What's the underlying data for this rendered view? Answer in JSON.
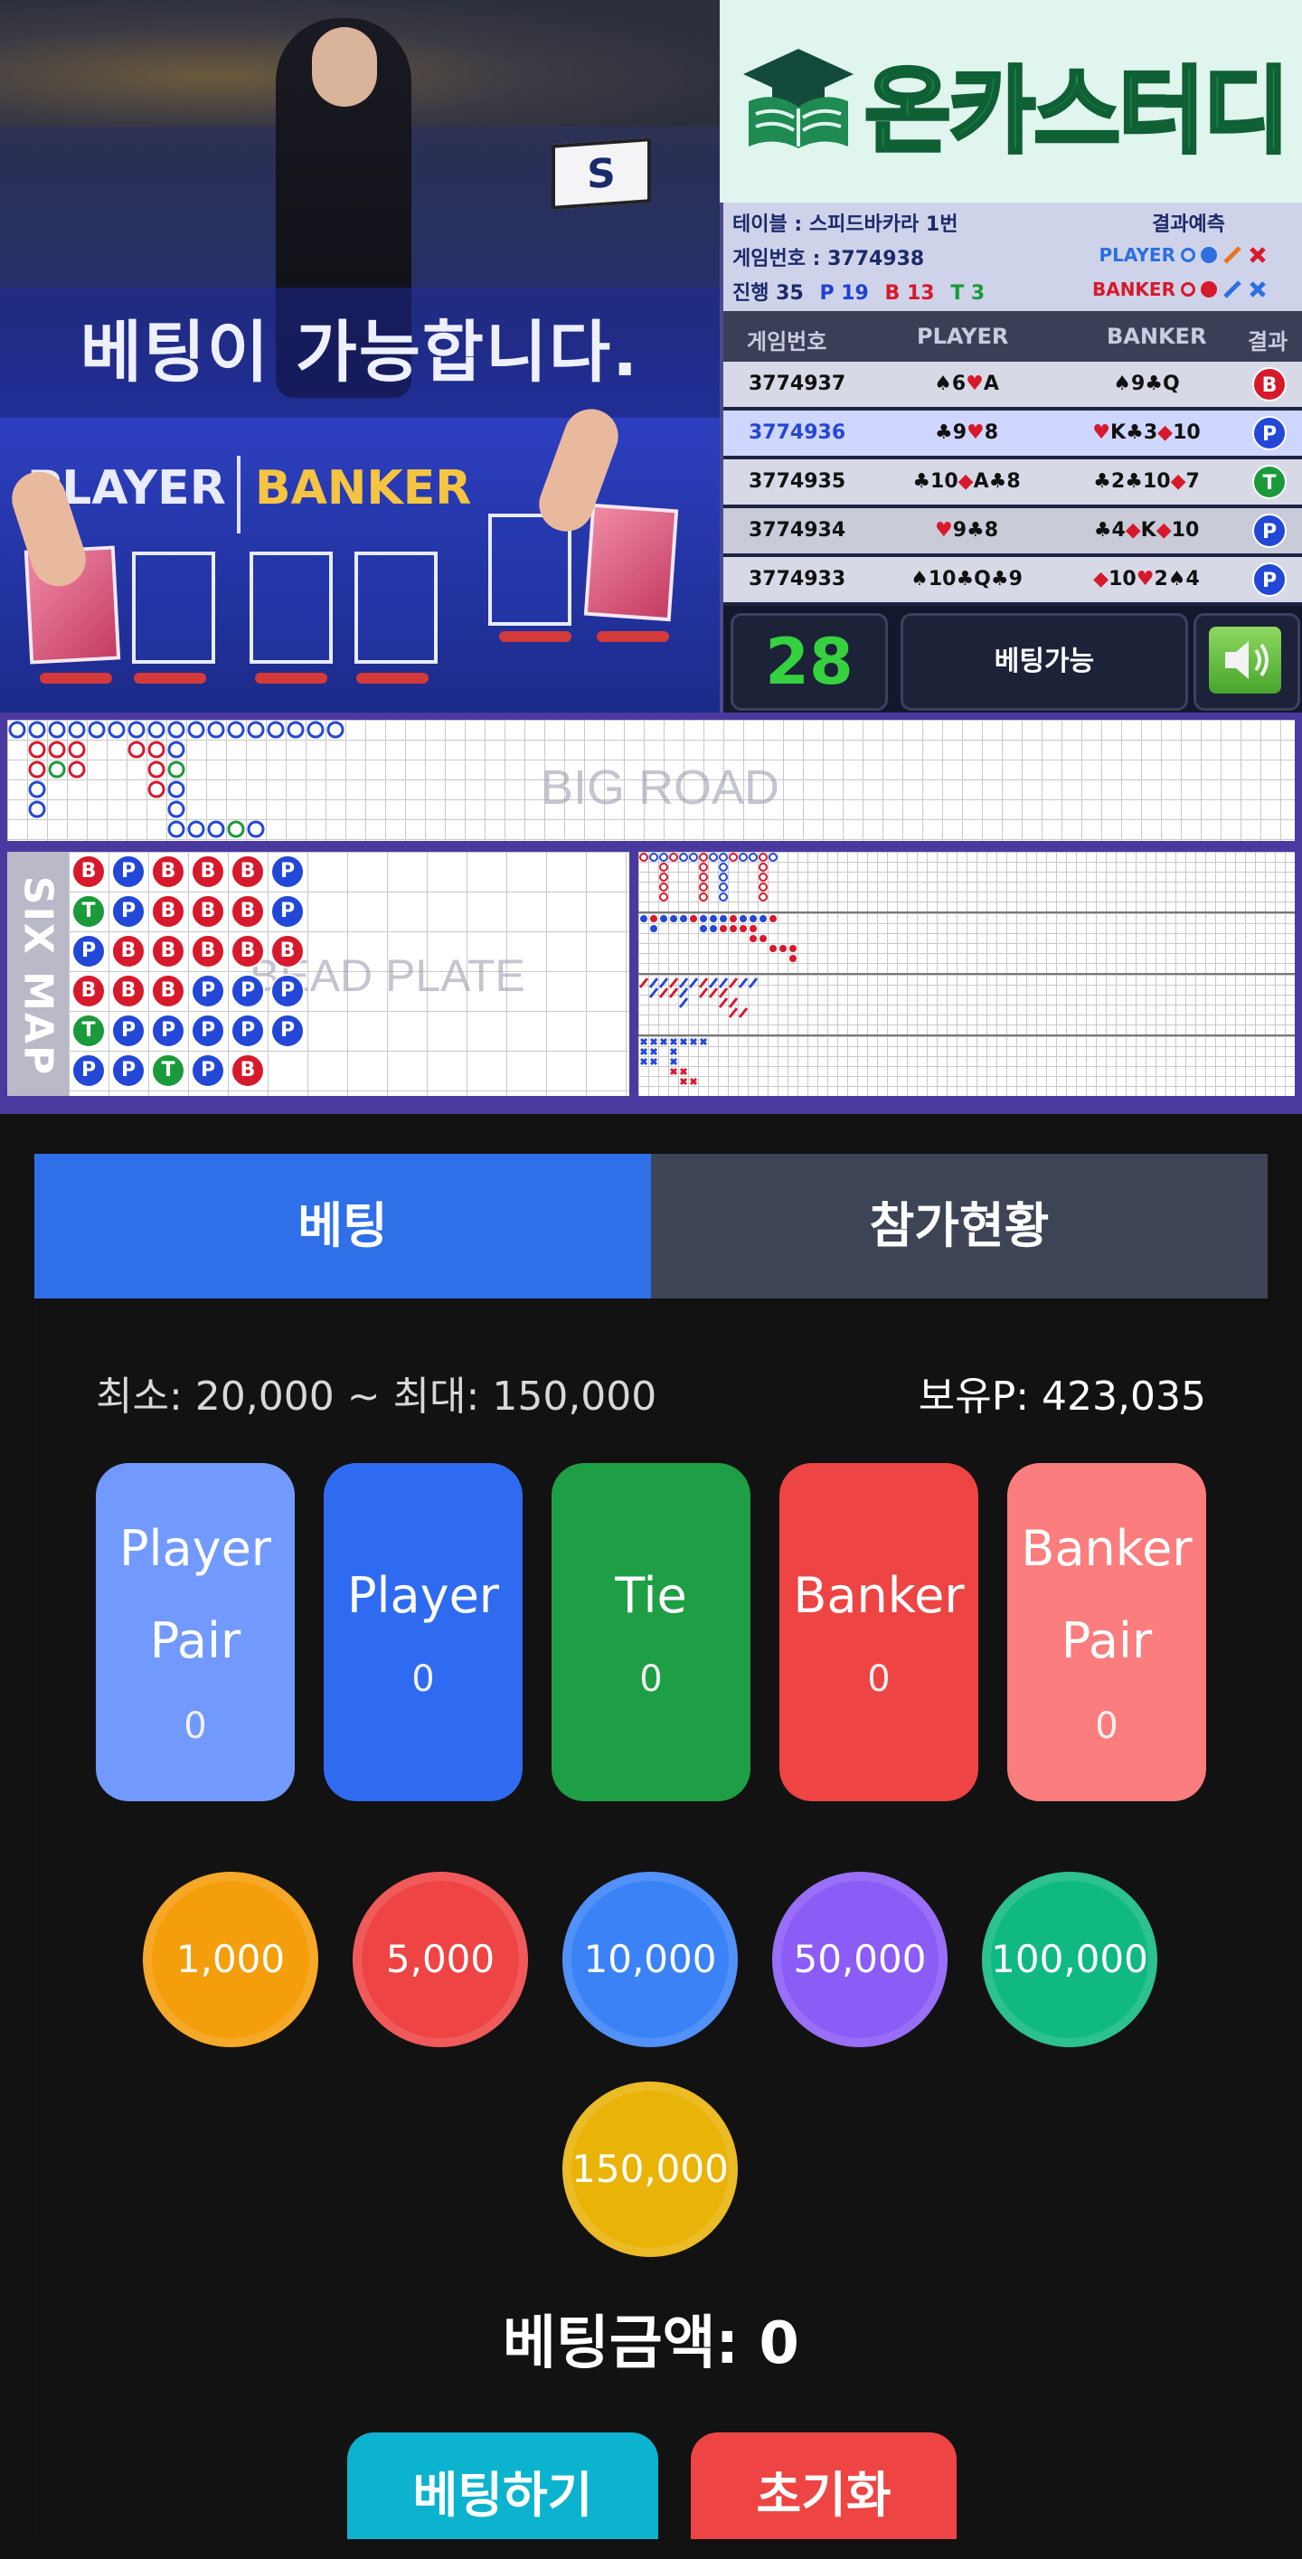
{
  "video": {
    "overlay_text": "베팅이 가능합니다.",
    "player_label": "PLAYER",
    "banker_label": "BANKER",
    "sign_letter": "S"
  },
  "brand": {
    "name": "온카스터디"
  },
  "info": {
    "table_label": "테이블 : 스피드바카라 1번",
    "game_no_label": "게임번호 : 3774938",
    "progress_label": "진행",
    "progress_count": "35",
    "player_count": "P 19",
    "banker_count": "B 13",
    "tie_count": "T 3",
    "prediction_title": "결과예측",
    "pred_player": "PLAYER",
    "pred_banker": "BANKER",
    "headers": [
      "게임번호",
      "PLAYER",
      "BANKER",
      "결과"
    ],
    "history": [
      {
        "id": "3774937",
        "player": [
          [
            "♠",
            "6",
            "b"
          ],
          [
            "♥",
            "A",
            "r"
          ]
        ],
        "banker": [
          [
            "♠",
            "9",
            "b"
          ],
          [
            "♣",
            "Q",
            "b"
          ]
        ],
        "result": "B"
      },
      {
        "id": "3774936",
        "player": [
          [
            "♣",
            "9",
            "b"
          ],
          [
            "♥",
            "8",
            "r"
          ]
        ],
        "banker": [
          [
            "♥",
            "K",
            "r"
          ],
          [
            "♣",
            "3",
            "b"
          ],
          [
            "◆",
            "10",
            "r"
          ]
        ],
        "result": "P"
      },
      {
        "id": "3774935",
        "player": [
          [
            "♣",
            "10",
            "b"
          ],
          [
            "◆",
            "A",
            "r"
          ],
          [
            "♣",
            "8",
            "b"
          ]
        ],
        "banker": [
          [
            "♣",
            "2",
            "b"
          ],
          [
            "♣",
            "10",
            "b"
          ],
          [
            "◆",
            "7",
            "r"
          ]
        ],
        "result": "T"
      },
      {
        "id": "3774934",
        "player": [
          [
            "♥",
            "9",
            "r"
          ],
          [
            "♣",
            "8",
            "b"
          ]
        ],
        "banker": [
          [
            "♣",
            "4",
            "b"
          ],
          [
            "◆",
            "K",
            "r"
          ],
          [
            "◆",
            "10",
            "r"
          ]
        ],
        "result": "P"
      },
      {
        "id": "3774933",
        "player": [
          [
            "♠",
            "10",
            "b"
          ],
          [
            "♣",
            "Q",
            "b"
          ],
          [
            "♣",
            "9",
            "b"
          ]
        ],
        "banker": [
          [
            "◆",
            "10",
            "r"
          ],
          [
            "♥",
            "2",
            "r"
          ],
          [
            "♠",
            "4",
            "b"
          ]
        ],
        "result": "P"
      }
    ],
    "timer": "28",
    "status": "베팅가능"
  },
  "roads": {
    "big_road_label": "BIG ROAD",
    "six_map_label": "SIX MAP",
    "bead_plate_label": "BEAD PLATE",
    "bead_plate": [
      [
        "B",
        "P",
        "B",
        "B",
        "B",
        "P"
      ],
      [
        "T",
        "P",
        "B",
        "B",
        "B",
        "P"
      ],
      [
        "P",
        "B",
        "B",
        "B",
        "B",
        "B"
      ],
      [
        "B",
        "B",
        "B",
        "P",
        "P",
        "P"
      ],
      [
        "T",
        "P",
        "P",
        "P",
        "P",
        "P"
      ],
      [
        "P",
        "P",
        "T",
        "P",
        "B",
        ""
      ]
    ]
  },
  "betting": {
    "tabs": [
      "베팅",
      "참가현황"
    ],
    "limits": "최소: 20,000 ~ 최대: 150,000",
    "points": "보유P: 423,035",
    "options": [
      {
        "name": "player-pair",
        "label1": "Player",
        "label2": "Pair",
        "amount": "0",
        "color": "#729afe"
      },
      {
        "name": "player",
        "label1": "Player",
        "label2": "",
        "amount": "0",
        "color": "#2f6bf0"
      },
      {
        "name": "tie",
        "label1": "Tie",
        "label2": "",
        "amount": "0",
        "color": "#1e9e45"
      },
      {
        "name": "banker",
        "label1": "Banker",
        "label2": "",
        "amount": "0",
        "color": "#ee4444"
      },
      {
        "name": "banker-pair",
        "label1": "Banker",
        "label2": "Pair",
        "amount": "0",
        "color": "#fb7d7d"
      }
    ],
    "chips": [
      {
        "value": "1,000",
        "color": "#f59e0b"
      },
      {
        "value": "5,000",
        "color": "#ef4444"
      },
      {
        "value": "10,000",
        "color": "#3b82f6"
      },
      {
        "value": "50,000",
        "color": "#8b5cf6"
      },
      {
        "value": "100,000",
        "color": "#10b981"
      },
      {
        "value": "150,000",
        "color": "#eab308"
      }
    ],
    "total_label": "베팅금액: 0",
    "bet_button": "베팅하기",
    "reset_button": "초기화"
  }
}
